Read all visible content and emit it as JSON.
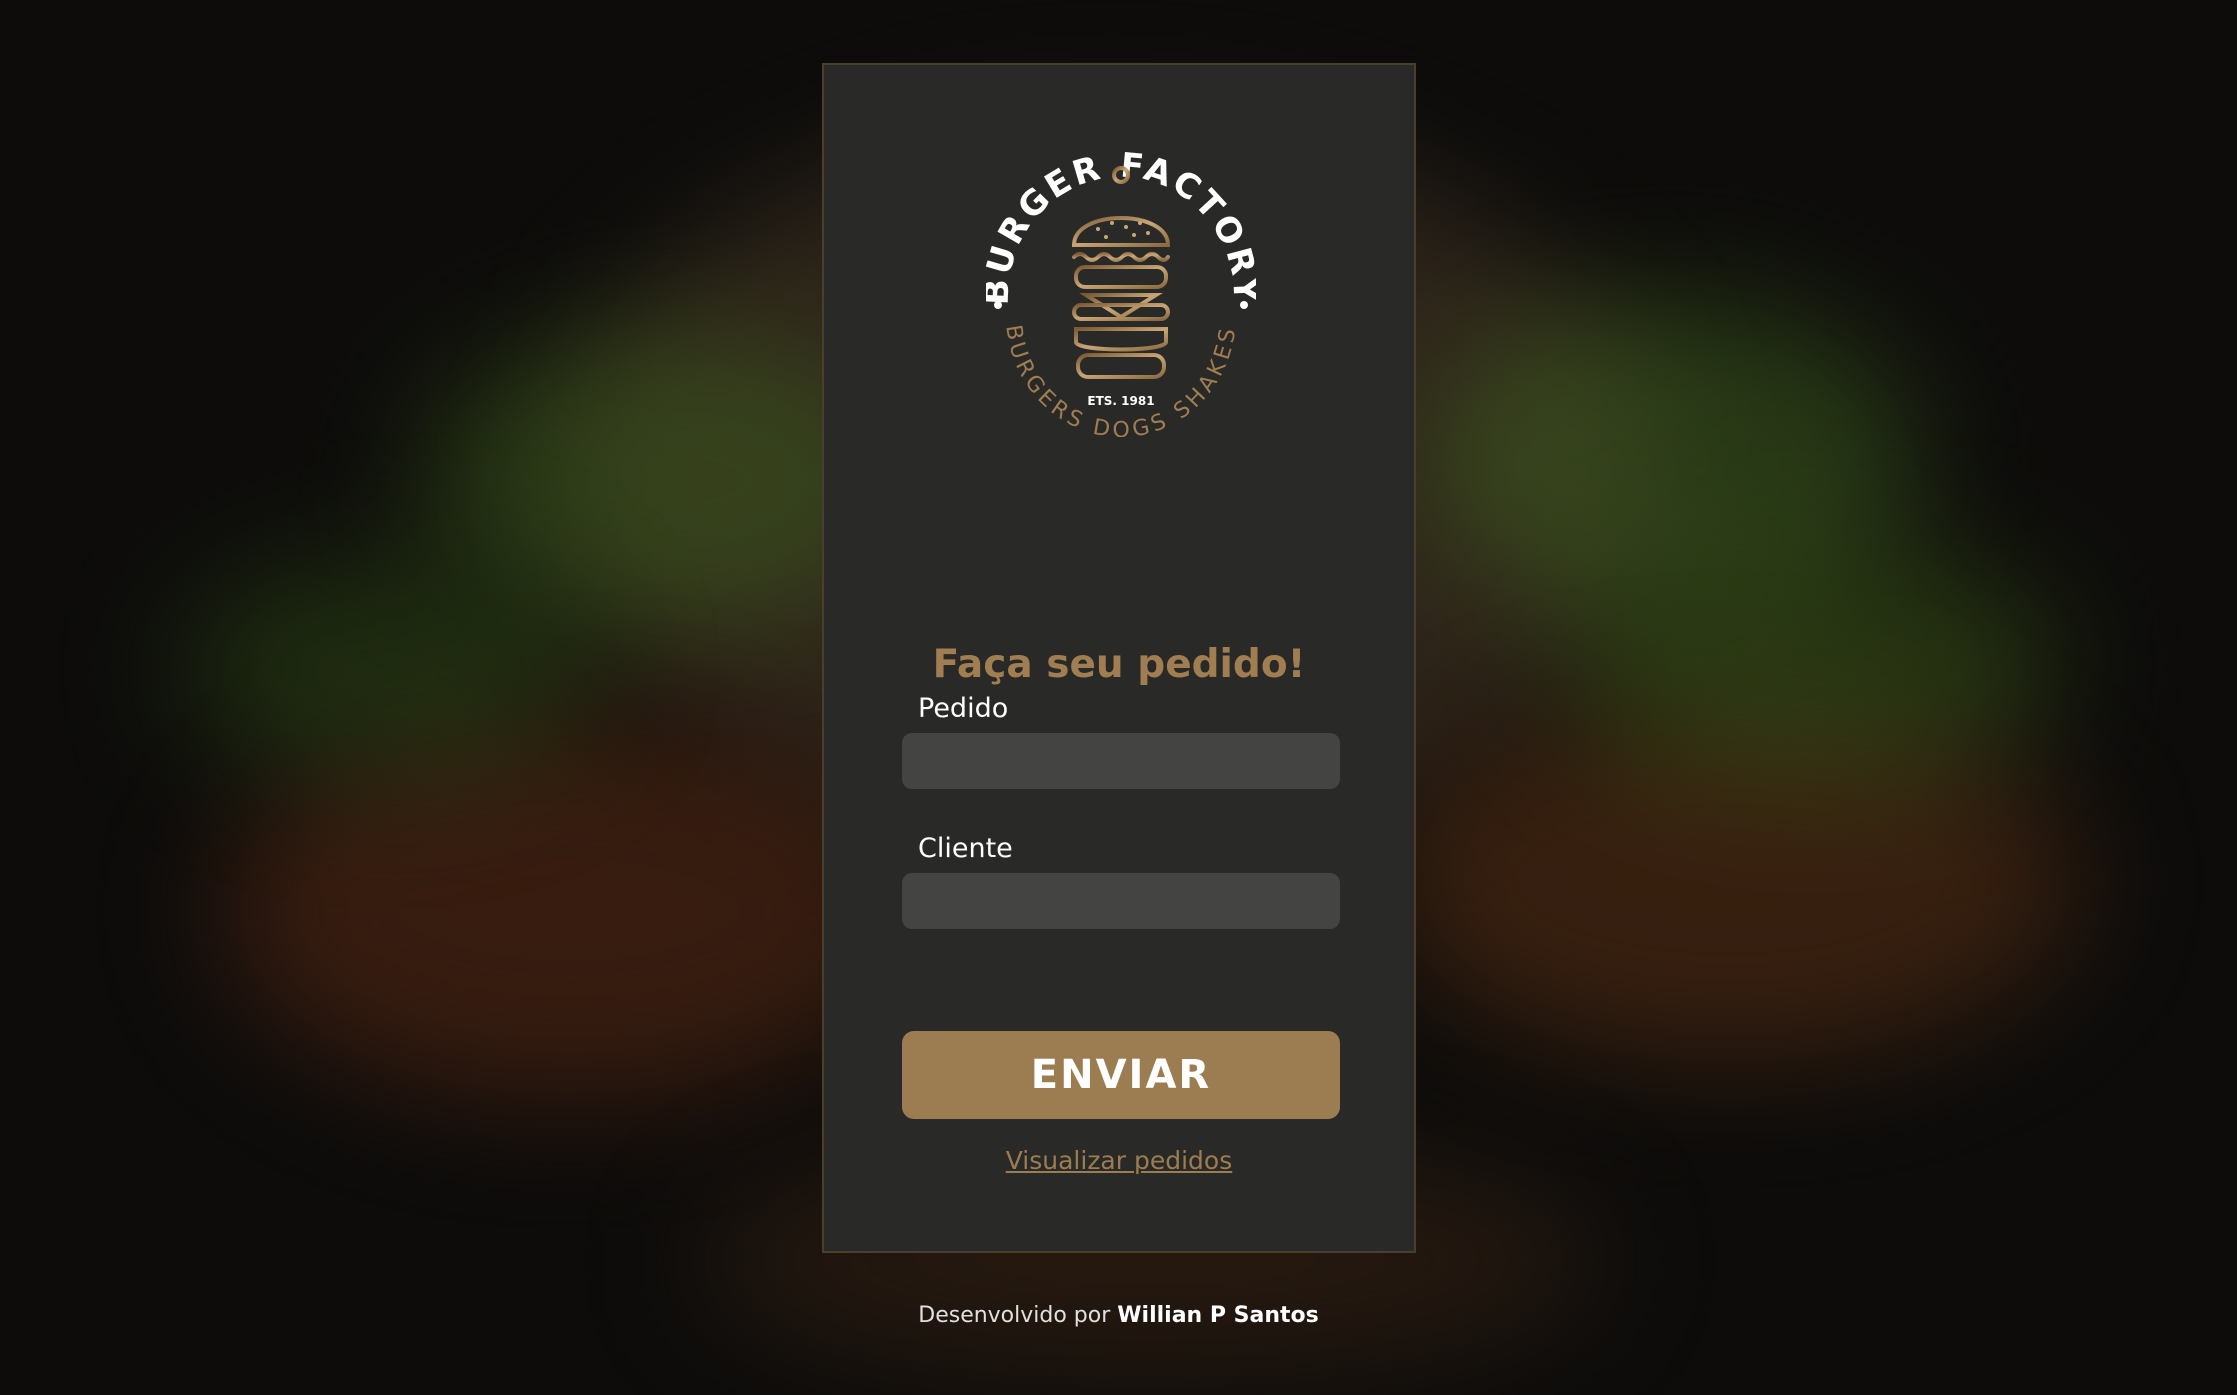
{
  "colors": {
    "accent": "#9c7d51",
    "title": "#a07e51",
    "card_bg": "#292927",
    "input_bg": "#444442"
  },
  "logo": {
    "top_text": "BURGER FACTORY",
    "bottom_text": "BURGERS DOGS SHAKES",
    "established": "ETS. 1981"
  },
  "form": {
    "title": "Faça seu pedido!",
    "pedido_label": "Pedido",
    "pedido_value": "",
    "cliente_label": "Cliente",
    "cliente_value": "",
    "submit_label": "ENVIAR",
    "view_orders_link": "Visualizar pedidos"
  },
  "footer": {
    "prefix": "Desenvolvido por",
    "author": "Willian P Santos"
  }
}
